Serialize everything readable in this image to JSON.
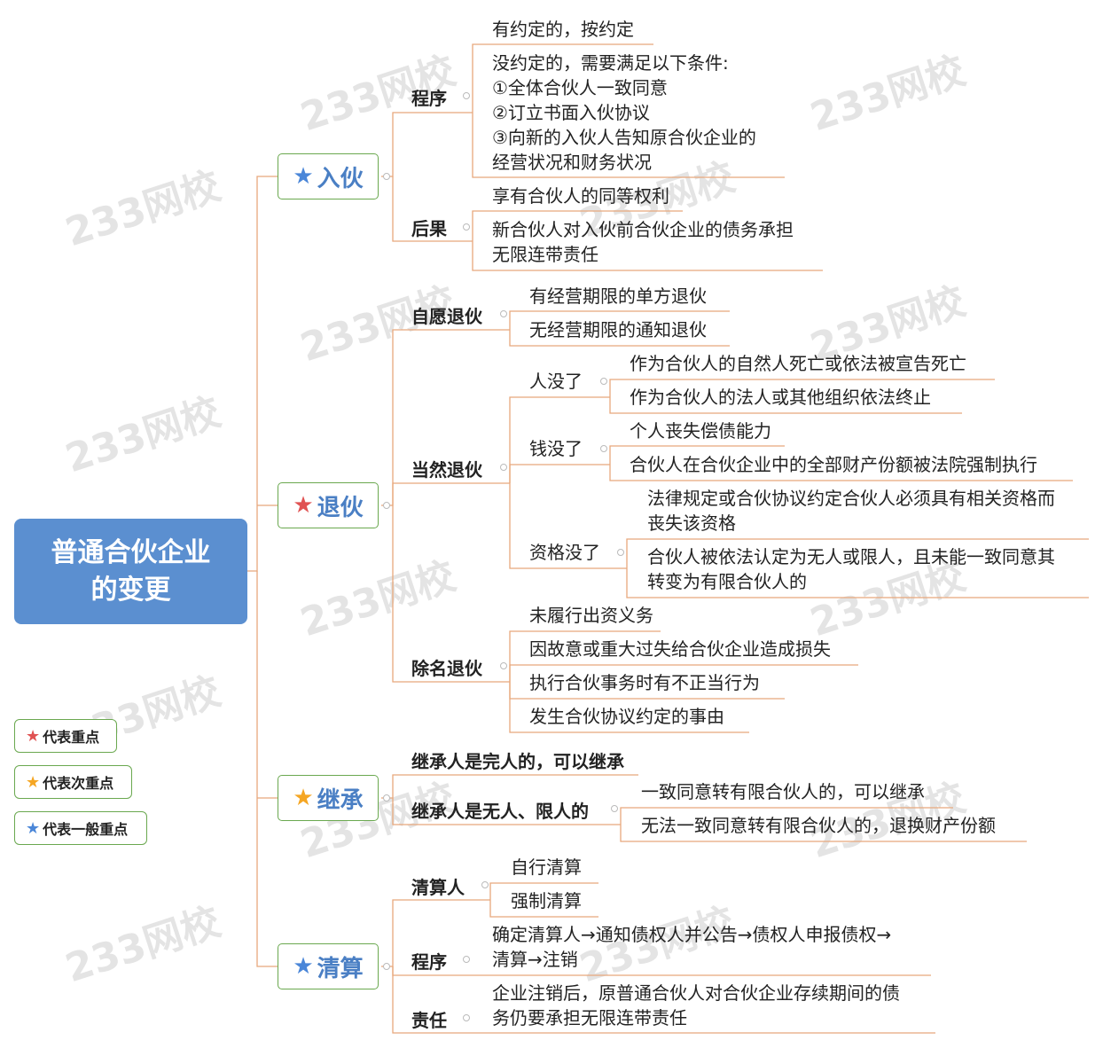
{
  "root": "普通合伙企业\n的变更",
  "colors": {
    "line": "#e8a87c",
    "root_bg": "#5b8fd0",
    "box_border": "#6aa84f",
    "star_red": "#e05252",
    "star_orange": "#f5a623",
    "star_blue": "#4a86d8"
  },
  "watermark": "233网校",
  "branches": {
    "join": {
      "title": "入伙",
      "procedure": "程序",
      "p1": "有约定的，按约定",
      "p2": "没约定的，需要满足以下条件:\n①全体合伙人一致同意\n②订立书面入伙协议\n③向新的入伙人告知原合伙企业的\n经营状况和财务状况",
      "consequence": "后果",
      "c1": "享有合伙人的同等权利",
      "c2": "新合伙人对入伙前合伙企业的债务承担\n无限连带责任"
    },
    "exit": {
      "title": "退伙",
      "voluntary": "自愿退伙",
      "v1": "有经营期限的单方退伙",
      "v2": "无经营期限的通知退伙",
      "natural": "当然退伙",
      "person": "人没了",
      "person1": "作为合伙人的自然人死亡或依法被宣告死亡",
      "person2": "作为合伙人的法人或其他组织依法终止",
      "money": "钱没了",
      "money1": "个人丧失偿债能力",
      "money2": "合伙人在合伙企业中的全部财产份额被法院强制执行",
      "qual": "资格没了",
      "qual1": "法律规定或合伙协议约定合伙人必须具有相关资格而\n丧失该资格",
      "qual2": "合伙人被依法认定为无人或限人，且未能一致同意其\n转变为有限合伙人的",
      "expel": "除名退伙",
      "e1": "未履行出资义务",
      "e2": "因故意或重大过失给合伙企业造成损失",
      "e3": "执行合伙事务时有不正当行为",
      "e4": "发生合伙协议约定的事由"
    },
    "inherit": {
      "title": "继承",
      "i1": "继承人是完人的，可以继承",
      "i2": "继承人是无人、限人的",
      "i2a": "一致同意转有限合伙人的，可以继承",
      "i2b": "无法一致同意转有限合伙人的，退换财产份额"
    },
    "liquidate": {
      "title": "清算",
      "liquidator": "清算人",
      "l1": "自行清算",
      "l2": "强制清算",
      "procedure": "程序",
      "proc_text": "确定清算人→通知债权人并公告→债权人申报债权→\n清算→注销",
      "liability": "责任",
      "liab_text": "企业注销后，原普通合伙人对合伙企业存续期间的债\n务仍要承担无限连带责任"
    }
  },
  "legend": [
    {
      "star": "red",
      "label": "代表重点"
    },
    {
      "star": "orange",
      "label": "代表次重点"
    },
    {
      "star": "blue",
      "label": "代表一般重点"
    }
  ]
}
